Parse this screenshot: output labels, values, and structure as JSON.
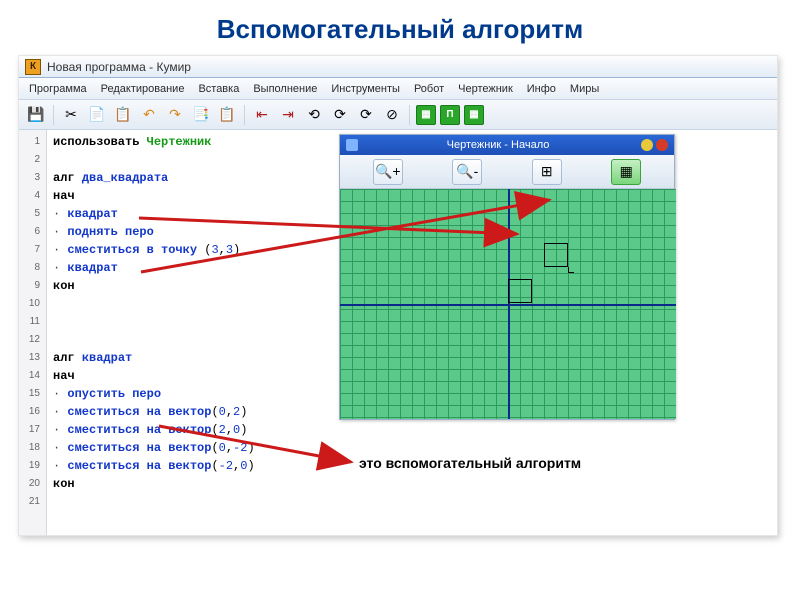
{
  "slide": {
    "title": "Вспомогательный алгоритм"
  },
  "window": {
    "title": "Новая программа - Кумир",
    "app_icon_letter": "К"
  },
  "menu": {
    "items": [
      "Программа",
      "Редактирование",
      "Вставка",
      "Выполнение",
      "Инструменты",
      "Робот",
      "Чертежник",
      "Инфо",
      "Миры"
    ]
  },
  "toolbar": {
    "icons": [
      "💾",
      "✂",
      "📄",
      "📋",
      "↶",
      "↷",
      "📑",
      "📋",
      "⇤",
      "⇥",
      "⟲",
      "⟳",
      "⟳",
      "⊘"
    ],
    "green_icons": [
      "▦",
      "П",
      "▦"
    ]
  },
  "code": {
    "lines": [
      {
        "n": 1,
        "tokens": [
          {
            "t": "использовать ",
            "c": "kw"
          },
          {
            "t": "Чертежник",
            "c": "grn"
          }
        ]
      },
      {
        "n": 2,
        "tokens": []
      },
      {
        "n": 3,
        "tokens": [
          {
            "t": "алг ",
            "c": "kw"
          },
          {
            "t": "два_квадрата",
            "c": "cmd"
          }
        ]
      },
      {
        "n": 4,
        "tokens": [
          {
            "t": "нач",
            "c": "kw"
          }
        ]
      },
      {
        "n": 5,
        "tokens": [
          {
            "t": "· ",
            "c": "dot"
          },
          {
            "t": "квадрат",
            "c": "cmd"
          }
        ]
      },
      {
        "n": 6,
        "tokens": [
          {
            "t": "· ",
            "c": "dot"
          },
          {
            "t": "поднять перо",
            "c": "cmd"
          }
        ]
      },
      {
        "n": 7,
        "tokens": [
          {
            "t": "· ",
            "c": "dot"
          },
          {
            "t": "сместиться в точку ",
            "c": "cmd"
          },
          {
            "t": "(",
            "c": ""
          },
          {
            "t": "3",
            "c": "num"
          },
          {
            "t": ",",
            "c": ""
          },
          {
            "t": "3",
            "c": "num"
          },
          {
            "t": ")",
            "c": ""
          }
        ]
      },
      {
        "n": 8,
        "tokens": [
          {
            "t": "· ",
            "c": "dot"
          },
          {
            "t": "квадрат",
            "c": "cmd"
          }
        ]
      },
      {
        "n": 9,
        "tokens": [
          {
            "t": "кон",
            "c": "kw"
          }
        ]
      },
      {
        "n": 10,
        "tokens": []
      },
      {
        "n": 11,
        "tokens": []
      },
      {
        "n": 12,
        "tokens": []
      },
      {
        "n": 13,
        "tokens": [
          {
            "t": "алг ",
            "c": "kw"
          },
          {
            "t": "квадрат",
            "c": "cmd"
          }
        ]
      },
      {
        "n": 14,
        "tokens": [
          {
            "t": "нач",
            "c": "kw"
          }
        ]
      },
      {
        "n": 15,
        "tokens": [
          {
            "t": "· ",
            "c": "dot"
          },
          {
            "t": "опустить перо",
            "c": "cmd"
          }
        ]
      },
      {
        "n": 16,
        "tokens": [
          {
            "t": "· ",
            "c": "dot"
          },
          {
            "t": "сместиться на вектор",
            "c": "cmd"
          },
          {
            "t": "(",
            "c": ""
          },
          {
            "t": "0",
            "c": "num"
          },
          {
            "t": ",",
            "c": ""
          },
          {
            "t": "2",
            "c": "num"
          },
          {
            "t": ")",
            "c": ""
          }
        ]
      },
      {
        "n": 17,
        "tokens": [
          {
            "t": "· ",
            "c": "dot"
          },
          {
            "t": "сместиться на вектор",
            "c": "cmd"
          },
          {
            "t": "(",
            "c": ""
          },
          {
            "t": "2",
            "c": "num"
          },
          {
            "t": ",",
            "c": ""
          },
          {
            "t": "0",
            "c": "num"
          },
          {
            "t": ")",
            "c": ""
          }
        ]
      },
      {
        "n": 18,
        "tokens": [
          {
            "t": "· ",
            "c": "dot"
          },
          {
            "t": "сместиться на вектор",
            "c": "cmd"
          },
          {
            "t": "(",
            "c": ""
          },
          {
            "t": "0",
            "c": "num"
          },
          {
            "t": ",",
            "c": ""
          },
          {
            "t": "-2",
            "c": "num"
          },
          {
            "t": ")",
            "c": ""
          }
        ]
      },
      {
        "n": 19,
        "tokens": [
          {
            "t": "· ",
            "c": "dot"
          },
          {
            "t": "сместиться на вектор",
            "c": "cmd"
          },
          {
            "t": "(",
            "c": ""
          },
          {
            "t": "-2",
            "c": "num"
          },
          {
            "t": ",",
            "c": ""
          },
          {
            "t": "0",
            "c": "num"
          },
          {
            "t": ")",
            "c": ""
          }
        ]
      },
      {
        "n": 20,
        "tokens": [
          {
            "t": "кон",
            "c": "kw"
          }
        ]
      },
      {
        "n": 21,
        "tokens": []
      }
    ]
  },
  "panel": {
    "title": "Чертежник - Начало",
    "tool_icons": [
      "🔍+",
      "🔍-",
      "⊞",
      "▦"
    ]
  },
  "annotation": {
    "text": "это вспомогательный алгоритм"
  },
  "colors": {
    "title_dot_min": "#e7c93a",
    "title_dot_close": "#d63b2a"
  }
}
